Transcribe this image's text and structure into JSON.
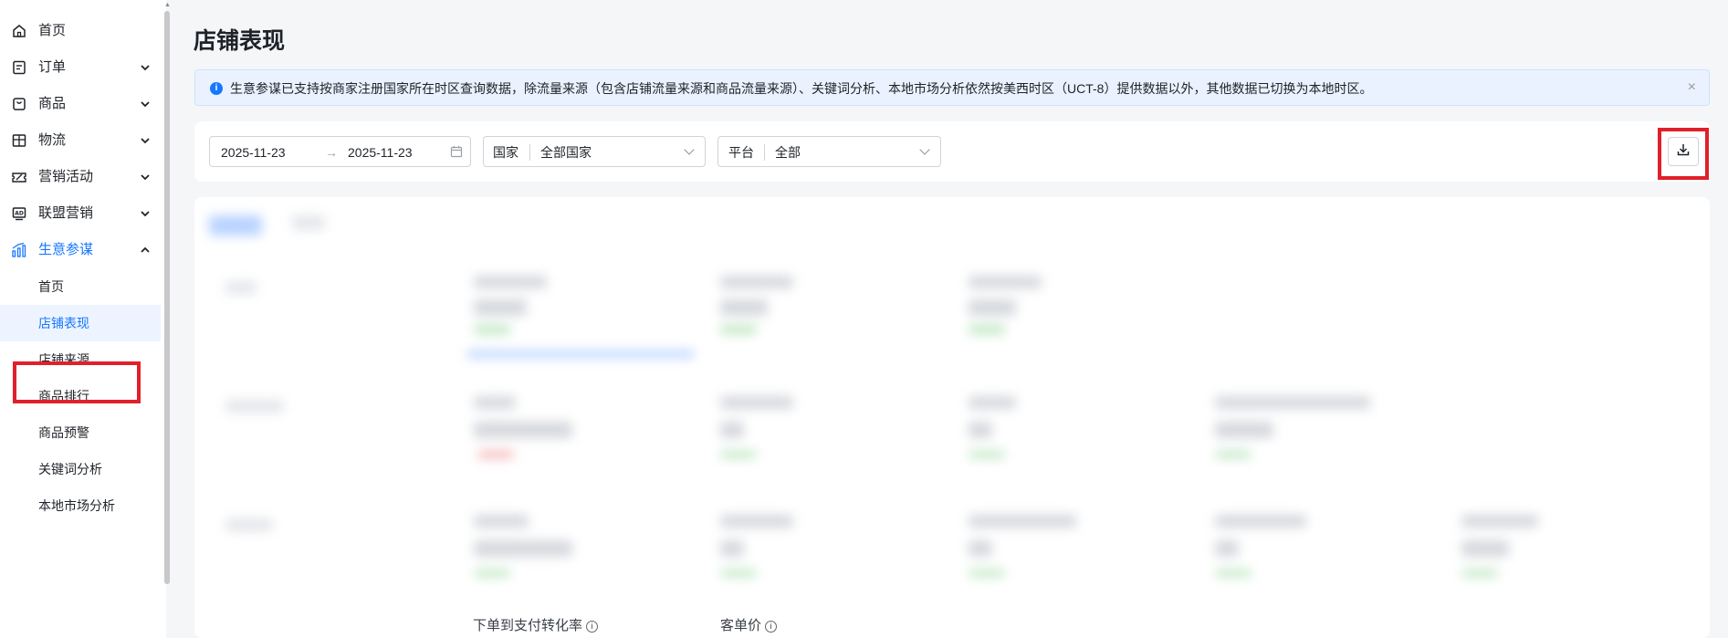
{
  "sidebar": {
    "items": [
      {
        "label": "首页",
        "icon": "home-icon",
        "expandable": false
      },
      {
        "label": "订单",
        "icon": "order-icon",
        "expandable": true
      },
      {
        "label": "商品",
        "icon": "product-icon",
        "expandable": true
      },
      {
        "label": "物流",
        "icon": "logistics-icon",
        "expandable": true
      },
      {
        "label": "营销活动",
        "icon": "ticket-icon",
        "expandable": true
      },
      {
        "label": "联盟营销",
        "icon": "ad-icon",
        "expandable": true
      },
      {
        "label": "生意参谋",
        "icon": "chart-icon",
        "expandable": true,
        "expanded": true
      }
    ],
    "sub_items": [
      {
        "label": "首页"
      },
      {
        "label": "店铺表现",
        "selected": true
      },
      {
        "label": "店铺来源"
      },
      {
        "label": "商品排行"
      },
      {
        "label": "商品预警"
      },
      {
        "label": "关键词分析"
      },
      {
        "label": "本地市场分析"
      }
    ]
  },
  "page": {
    "title": "店铺表现"
  },
  "notice": {
    "icon": "info-icon",
    "text": "生意参谋已支持按商家注册国家所在时区查询数据，除流量来源（包含店铺流量来源和商品流量来源）、关键词分析、本地市场分析依然按美西时区（UCT-8）提供数据以外，其他数据已切换为本地时区。",
    "close": "×"
  },
  "filters": {
    "date_start": "2025-11-23",
    "date_arrow": "→",
    "date_end": "2025-11-23",
    "country_label": "国家",
    "country_value": "全部国家",
    "platform_label": "平台",
    "platform_value": "全部"
  },
  "content": {
    "bottom_labels": [
      "下单到支付转化率",
      "客单价"
    ]
  },
  "colors": {
    "accent": "#1677ff",
    "highlight": "#e0202a"
  }
}
